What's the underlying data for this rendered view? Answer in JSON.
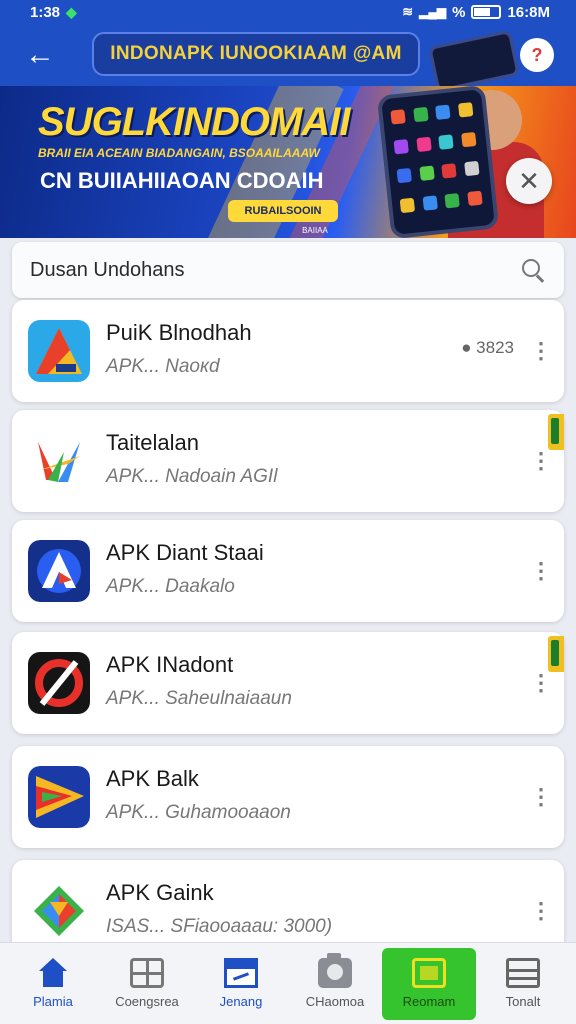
{
  "status_bar": {
    "time": "1:38",
    "right_text": "16:8M"
  },
  "header": {
    "title": "INDONAPK IUNOOKIAAM @AM",
    "avatar_label": "?"
  },
  "banner": {
    "headline": "SUGLKINDOMAII",
    "subline": "BRAII EIA ACEAIN BIADANGAIN, BSOAAILAAAW",
    "line2": "CN BUIIAHIIAOAN CDOAIH",
    "cta": "RUBAILSOOIN",
    "small": "BAIIAA",
    "accent_color": "#ffd83a",
    "brand_color": "#1e4fc4"
  },
  "search": {
    "placeholder": "Dusan Undohans"
  },
  "apps": [
    {
      "name": "PuiK Blnodhah",
      "subtitle": "APK...  Naoкd",
      "meta": "● 3823",
      "tag": false
    },
    {
      "name": "Taitelalan",
      "subtitle": "APK...  Nadoain AGIl",
      "meta": "",
      "tag": true
    },
    {
      "name": "APK  Diant Staai",
      "subtitle": "APK...  Daakalo",
      "meta": "",
      "tag": false
    },
    {
      "name": "APK  INadont",
      "subtitle": "APK...  Saheulnaiaaun",
      "meta": "",
      "tag": true
    },
    {
      "name": "APK Balk",
      "subtitle": "APK...  Guhamooaaon",
      "meta": "",
      "tag": false
    },
    {
      "name": "APK Gaink",
      "subtitle": "ISAS...  SFiaooaaau: 3000)",
      "meta": "",
      "tag": false
    }
  ],
  "bottom_nav": [
    {
      "label": "Plamia",
      "icon": "home-icon"
    },
    {
      "label": "Coengsrea",
      "icon": "grid-icon"
    },
    {
      "label": "Jenang",
      "icon": "calendar-icon"
    },
    {
      "label": "CHaomoa",
      "icon": "camera-icon"
    },
    {
      "label": "Reomam",
      "icon": "record-icon"
    },
    {
      "label": "Tonalt",
      "icon": "list-icon"
    }
  ]
}
